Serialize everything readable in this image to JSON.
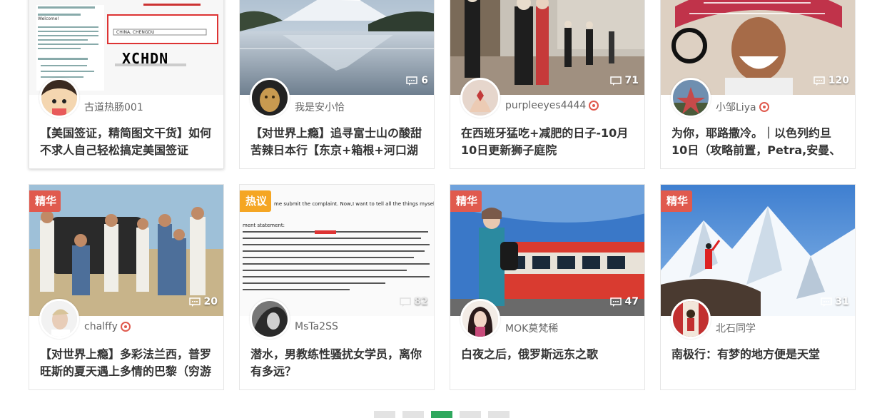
{
  "cards": [
    {
      "author": "古道热肠001",
      "title": "【美国签证，精简图文干货】如何不求人自己轻松搞定美国签证",
      "comments": "",
      "badge": "",
      "verified": false
    },
    {
      "author": "我是安小恰",
      "title": "【对世界上瘾】追寻富士山の酸甜苦辣日本行【东京+箱根+河口湖",
      "comments": "6",
      "badge": "",
      "verified": false
    },
    {
      "author": "purpleeyes4444",
      "title": "在西班牙猛吃+减肥的日子-10月10日更新狮子庭院",
      "comments": "71",
      "badge": "",
      "verified": true
    },
    {
      "author": "小邹Liya",
      "title": "为你，耶路撒冷。｜以色列约旦10日（攻略前置，Petra,安曼、入",
      "comments": "120",
      "badge": "",
      "verified": true
    },
    {
      "author": "chalffy",
      "title": "【对世界上瘾】多彩法兰西，普罗旺斯的夏天遇上多情的巴黎（穷游",
      "comments": "20",
      "badge": "精华",
      "verified": true
    },
    {
      "author": "MsTa2SS",
      "title": "潜水，男教练性骚扰女学员，离你有多远？",
      "comments": "82",
      "badge": "热议",
      "verified": false
    },
    {
      "author": "MOK莫梵稀",
      "title": "白夜之后，俄罗斯远东之歌",
      "comments": "47",
      "badge": "精华",
      "verified": false
    },
    {
      "author": "北石同学",
      "title": "南极行：有梦的地方便是天堂",
      "comments": "31",
      "badge": "精华",
      "verified": false
    }
  ],
  "thumb_text": {
    "card1_logo": "XCHDN",
    "card1_select": "CHINA, CHENGDU",
    "card1_welcome": "Welcome!",
    "card2_watermark": "",
    "card6_header": "me submit the complaint. Now,I want to tell all the things myself.It's easier fo",
    "card6_label": "ment statement:"
  },
  "colors": {
    "badge_red": "#e05a4e",
    "badge_gold": "#f5a623",
    "pager_active": "#2fa85e"
  },
  "icons": {
    "comment": "comment-bubble-icon",
    "verified": "verified-badge-icon"
  }
}
